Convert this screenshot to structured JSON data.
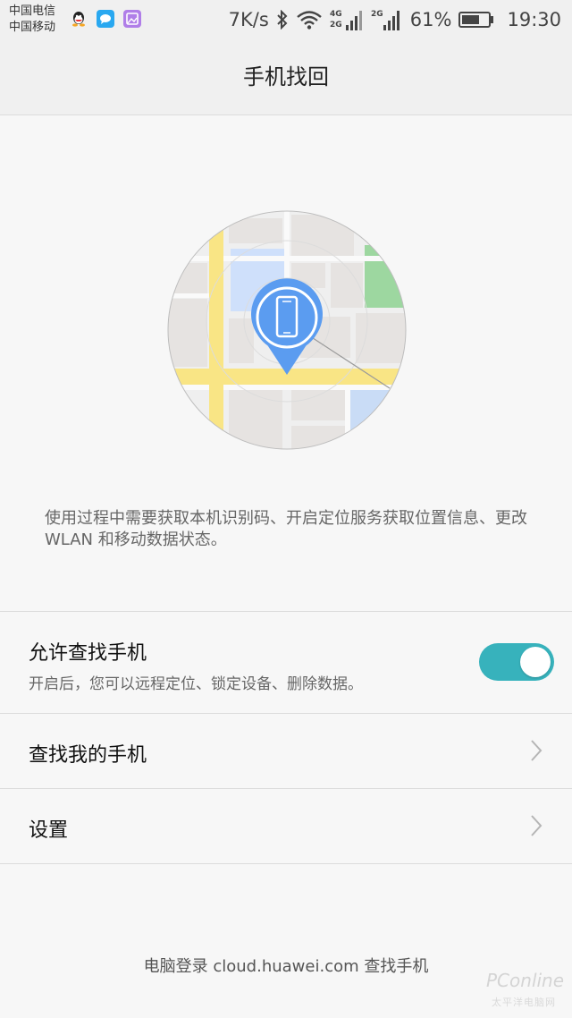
{
  "status_bar": {
    "carrier_1": "中国电信",
    "carrier_2": "中国移动",
    "notification_icons": [
      "qq-icon",
      "message-icon",
      "gallery-icon"
    ],
    "net_speed": "7K/s",
    "network_1": "4G",
    "network_1b": "2G",
    "network_2": "2G",
    "battery_percent": "61%",
    "time": "19:30"
  },
  "header": {
    "title": "手机找回"
  },
  "illustration": {
    "icon": "map-with-phone-pin-icon",
    "accent_color": "#5b9cf0"
  },
  "description": "使用过程中需要获取本机识别码、开启定位服务获取位置信息、更改 WLAN 和移动数据状态。",
  "settings": {
    "allow_find": {
      "title": "允许查找手机",
      "subtitle": "开启后，您可以远程定位、锁定设备、删除数据。",
      "enabled": true,
      "toggle_color": "#37b2bc"
    },
    "find_my_phone": {
      "title": "查找我的手机"
    },
    "settings_item": {
      "title": "设置"
    }
  },
  "footer": {
    "text": "电脑登录 cloud.huawei.com 查找手机"
  },
  "watermark": {
    "brand": "PConline",
    "sub": "太平洋电脑网"
  }
}
